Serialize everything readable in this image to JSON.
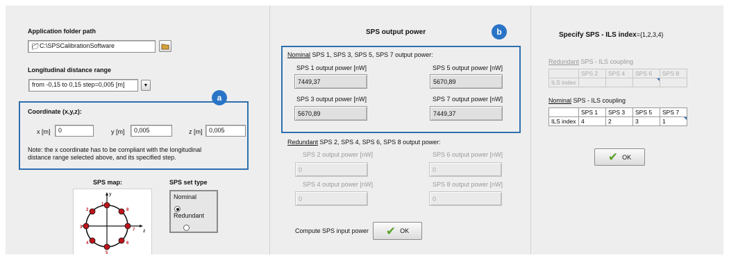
{
  "left": {
    "app_folder_label": "Application folder path",
    "app_folder_value": "C:\\SPSCalibrationSoftware",
    "distance_label": "Longitudinal distance range",
    "distance_value": "from -0,15 to 0,15 step=0,005 [m]",
    "coordinate_label": "Coordinate (x,y,z):",
    "x_label": "x [m]",
    "x_value": "0",
    "y_label": "y [m]",
    "y_value": "0,005",
    "z_label": "z [m]",
    "z_value": "0,005",
    "note_line1": "Note: the x coordinate has to be compliant with the longitudinal",
    "note_line2": "distance range selected above, and its specified step.",
    "badge_a": "a",
    "sps_map_label": "SPS map:",
    "sps_set_type_label": "SPS set type",
    "set_type_options": [
      "Nominal",
      "Redundant"
    ],
    "set_type_selected": "Nominal",
    "map": {
      "axis_y": "y",
      "axis_z": "z",
      "points": [
        "1",
        "2",
        "3",
        "4",
        "5",
        "6",
        "7",
        "8"
      ]
    }
  },
  "middle": {
    "title": "SPS output power",
    "badge_b": "b",
    "nominal_prefix": "Nominal",
    "nominal_suffix": " SPS 1, SPS 3, SPS 5, SPS 7 output power:",
    "nominal": [
      {
        "label": "SPS 1 output power [nW]",
        "value": "7449,37"
      },
      {
        "label": "SPS 5 output power [nW]",
        "value": "5670,89"
      },
      {
        "label": "SPS 3 output power [nW]",
        "value": "5670,89"
      },
      {
        "label": "SPS 7 output power [nW]",
        "value": "7449,37"
      }
    ],
    "redundant_prefix": "Redundant",
    "redundant_suffix": " SPS 2, SPS 4, SPS 6, SPS 8 output power:",
    "redundant": [
      {
        "label": "SPS 2 output power [nW]",
        "value": "0"
      },
      {
        "label": "SPS 6 output power [nW]",
        "value": "0"
      },
      {
        "label": "SPS 4 output power [nW]",
        "value": "0"
      },
      {
        "label": "SPS 8 output power [nW]",
        "value": "0"
      }
    ],
    "compute_label": "Compute SPS input power",
    "ok_label": "OK"
  },
  "right": {
    "title_bold": "Specify SPS - ILS index",
    "title_rest": "={1,2,3,4}",
    "redundant_prefix": "Redundant",
    "redundant_suffix": " SPS - ILS coupling",
    "redundant_headers": [
      "",
      "SPS 2",
      "SPS 4",
      "SPS 6",
      "SPS 8"
    ],
    "redundant_row": [
      "ILS index",
      "",
      "",
      "",
      ""
    ],
    "nominal_prefix": "Nominal",
    "nominal_suffix": " SPS - ILS coupling",
    "nominal_headers": [
      "",
      "SPS 1",
      "SPS 3",
      "SPS 5",
      "SPS 7"
    ],
    "nominal_row": [
      "ILS index",
      "4",
      "2",
      "3",
      "1"
    ],
    "ok_label": "OK"
  },
  "colors": {
    "highlight_border": "#2e6fb0",
    "badge": "#2a74c6",
    "map_point": "#c0141c",
    "check": "#5aa02c"
  }
}
